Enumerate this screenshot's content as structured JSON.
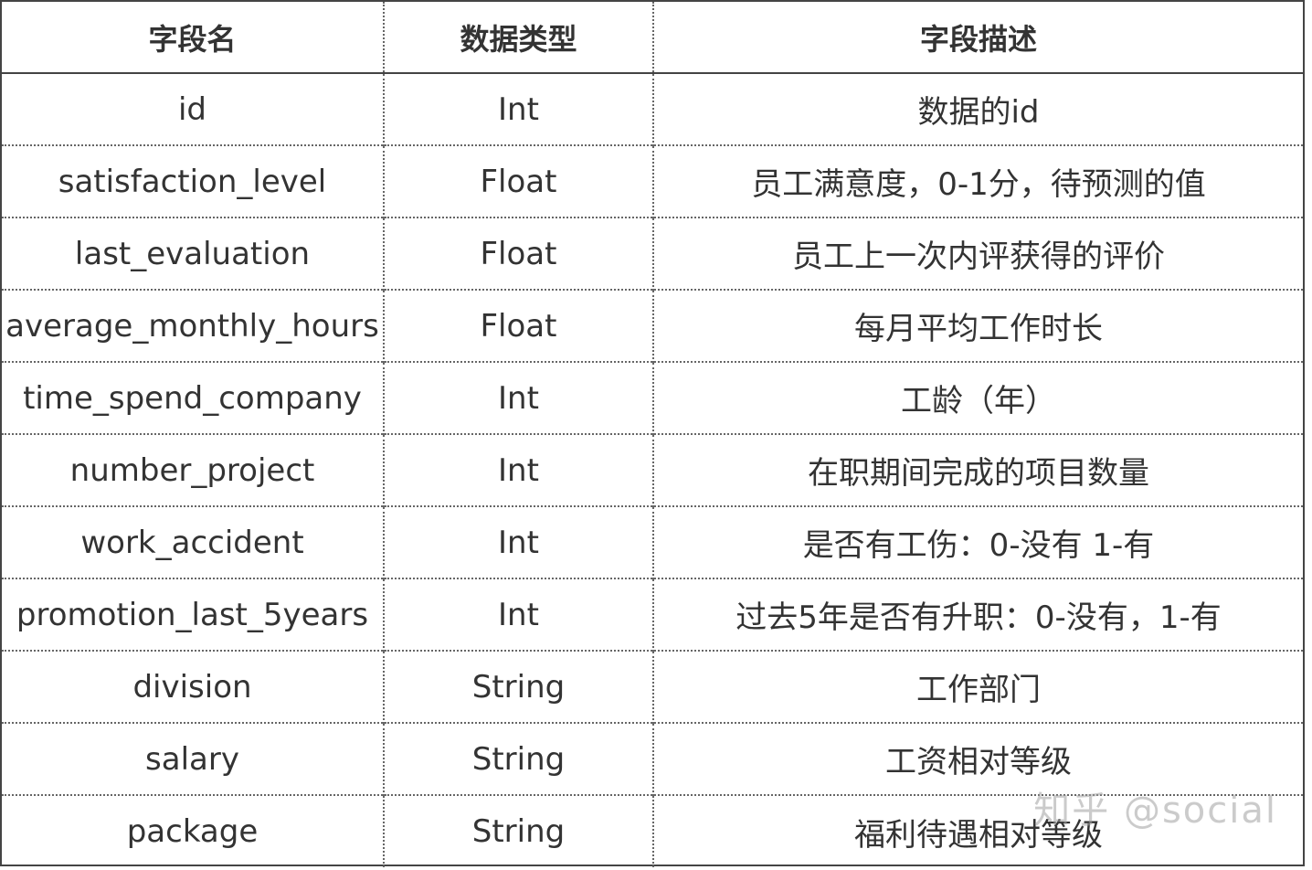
{
  "table": {
    "headers": [
      "字段名",
      "数据类型",
      "字段描述"
    ],
    "rows": [
      [
        "id",
        "Int",
        "数据的id"
      ],
      [
        "satisfaction_level",
        "Float",
        "员工满意度，0-1分，待预测的值"
      ],
      [
        "last_evaluation",
        "Float",
        "员工上一次内评获得的评价"
      ],
      [
        "average_monthly_hours",
        "Float",
        "每月平均工作时长"
      ],
      [
        "time_spend_company",
        "Int",
        "工龄（年）"
      ],
      [
        "number_project",
        "Int",
        "在职期间完成的项目数量"
      ],
      [
        "work_accident",
        "Int",
        "是否有工伤：0-没有 1-有"
      ],
      [
        "promotion_last_5years",
        "Int",
        "过去5年是否有升职：0-没有，1-有"
      ],
      [
        "division",
        "String",
        "工作部门"
      ],
      [
        "salary",
        "String",
        "工资相对等级"
      ],
      [
        "package",
        "String",
        "福利待遇相对等级"
      ]
    ]
  },
  "watermark": "知乎 @social"
}
